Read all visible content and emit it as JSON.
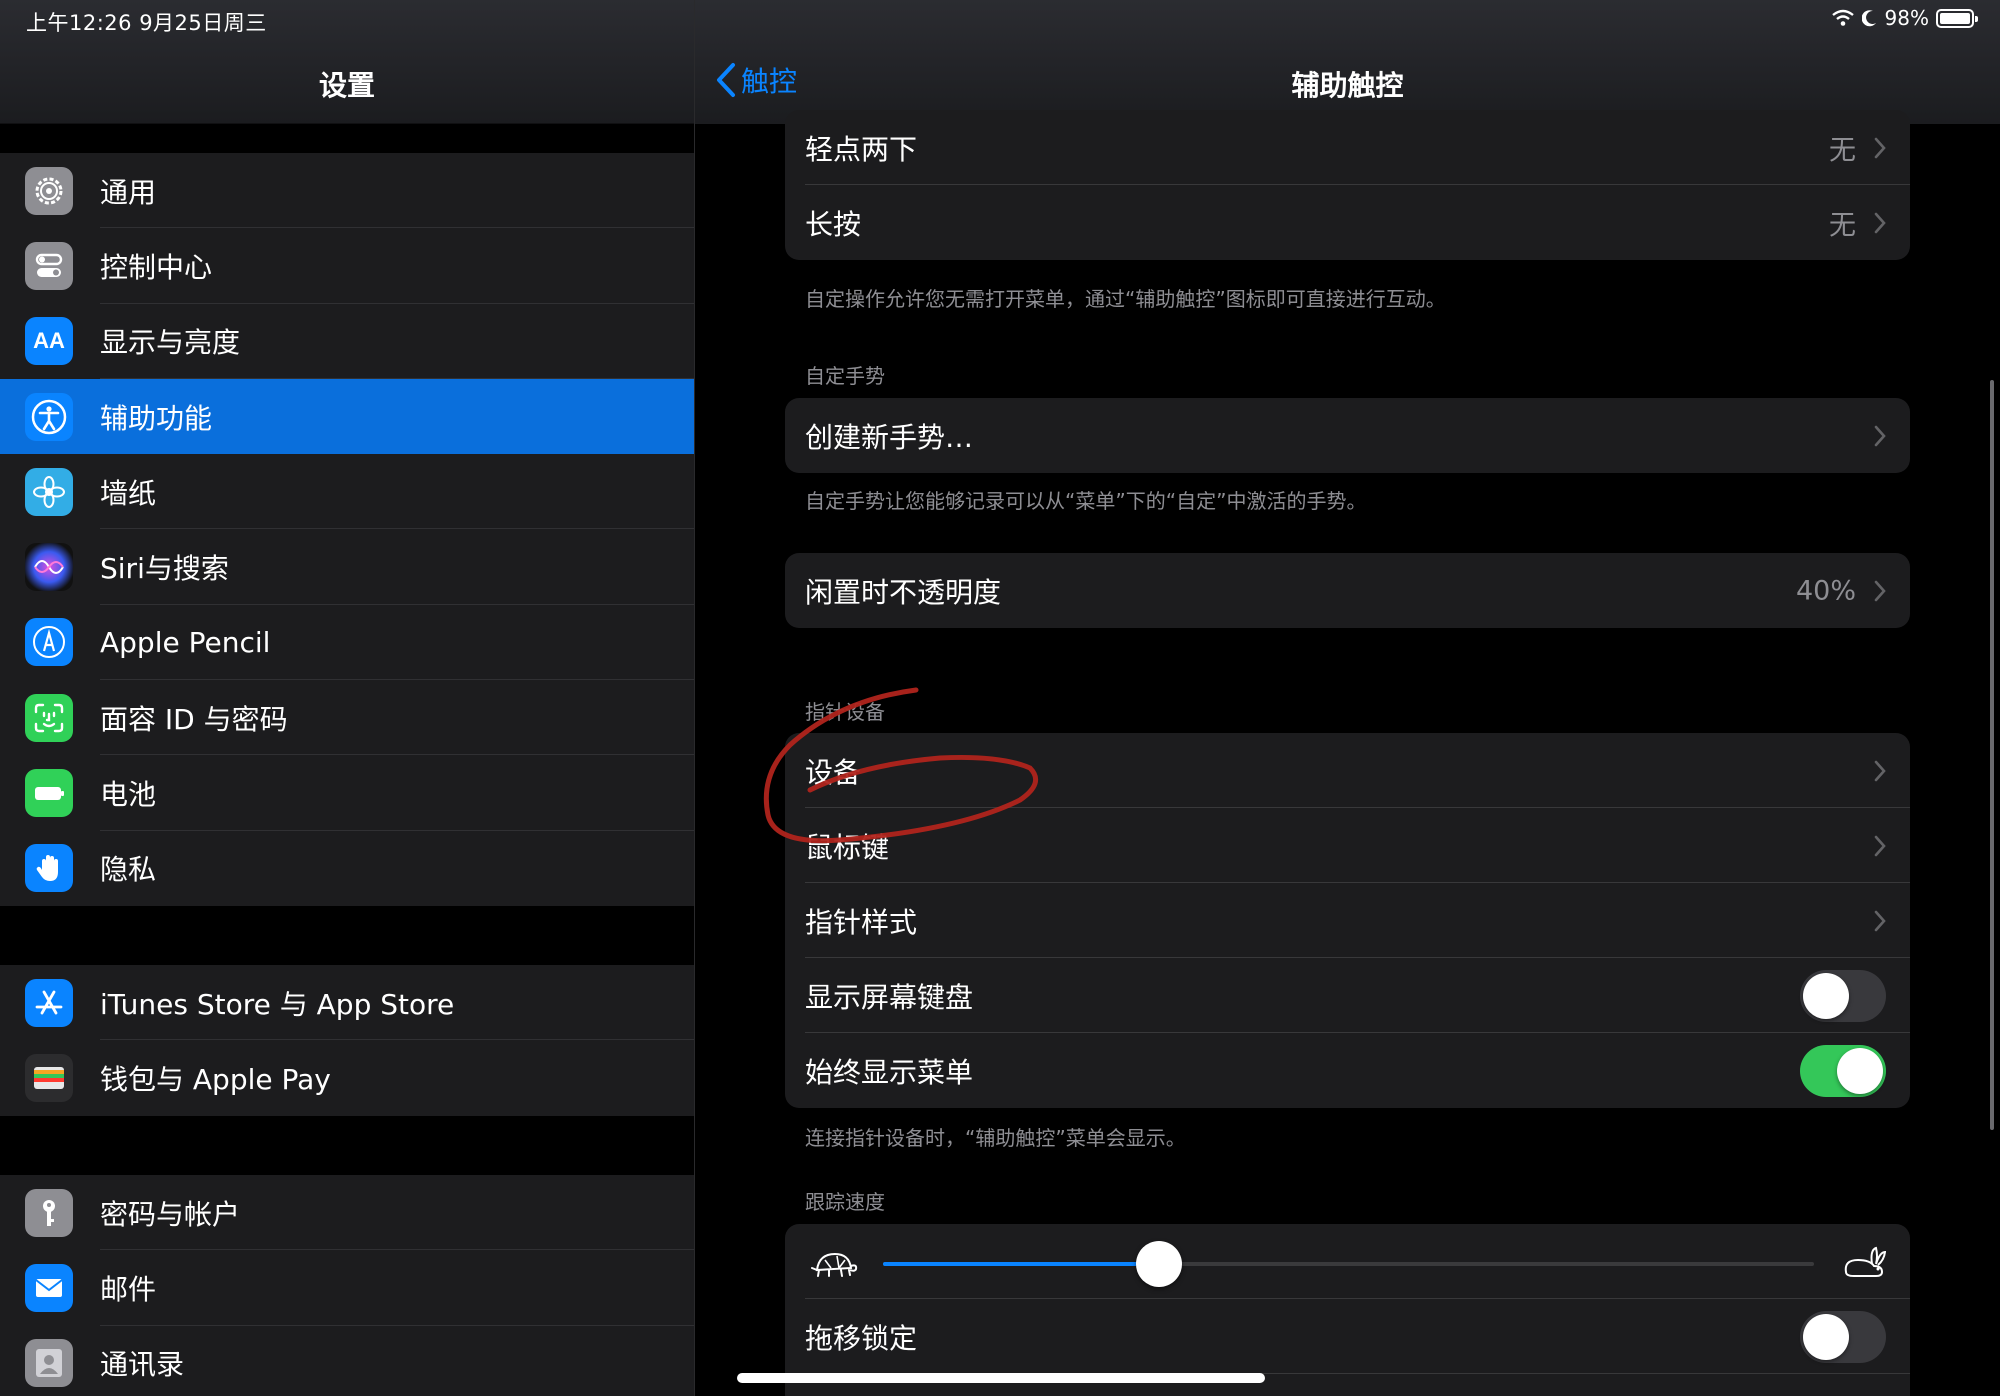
{
  "status_bar": {
    "time": "上午12:26  9月25日周三",
    "battery": "98%"
  },
  "sidebar": {
    "title": "设置",
    "groups": [
      [
        {
          "label": "通用",
          "icon": "gear-icon",
          "color": "#8e8e93"
        },
        {
          "label": "控制中心",
          "icon": "toggles-icon",
          "color": "#8e8e93"
        },
        {
          "label": "显示与亮度",
          "icon": "text-size-icon",
          "color": "#0a84ff"
        },
        {
          "label": "辅助功能",
          "icon": "accessibility-icon",
          "color": "#0a84ff",
          "selected": true
        },
        {
          "label": "墙纸",
          "icon": "flower-icon",
          "color": "#32ade6"
        },
        {
          "label": "Siri与搜索",
          "icon": "siri-icon",
          "color": "#1c1c1e"
        },
        {
          "label": "Apple Pencil",
          "icon": "pencil-icon",
          "color": "#0a84ff"
        },
        {
          "label": "面容 ID 与密码",
          "icon": "face-id-icon",
          "color": "#30d158"
        },
        {
          "label": "电池",
          "icon": "battery-icon",
          "color": "#30d158"
        },
        {
          "label": "隐私",
          "icon": "hand-icon",
          "color": "#0a84ff"
        }
      ],
      [
        {
          "label": "iTunes Store 与 App Store",
          "icon": "app-store-icon",
          "color": "#0a84ff"
        },
        {
          "label": "钱包与 Apple Pay",
          "icon": "wallet-icon",
          "color": "#2c2c2e"
        }
      ],
      [
        {
          "label": "密码与帐户",
          "icon": "key-icon",
          "color": "#8e8e93"
        },
        {
          "label": "邮件",
          "icon": "mail-icon",
          "color": "#0a84ff"
        },
        {
          "label": "通讯录",
          "icon": "contacts-icon",
          "color": "#8e8e93"
        }
      ]
    ]
  },
  "nav": {
    "back_label": "触控",
    "title": "辅助触控"
  },
  "custom_actions": {
    "rows": [
      {
        "label": "轻点两下",
        "value": "无"
      },
      {
        "label": "长按",
        "value": "无"
      }
    ],
    "footnote": "自定操作允许您无需打开菜单，通过“辅助触控”图标即可直接进行互动。"
  },
  "custom_gestures": {
    "header": "自定手势",
    "create_label": "创建新手势…",
    "footnote": "自定手势让您能够记录可以从“菜单”下的“自定”中激活的手势。"
  },
  "idle_opacity": {
    "label": "闲置时不透明度",
    "value": "40%"
  },
  "pointer_devices": {
    "header": "指针设备",
    "devices_label": "设备",
    "mouse_keys_label": "鼠标键",
    "pointer_style_label": "指针样式",
    "show_keyboard_label": "显示屏幕键盘",
    "show_keyboard_on": false,
    "always_show_menu_label": "始终显示菜单",
    "always_show_menu_on": true,
    "footnote": "连接指针设备时，“辅助触控”菜单会显示。"
  },
  "tracking_speed": {
    "header": "跟踪速度",
    "value_fraction": 0.296,
    "slow_icon": "turtle-icon",
    "fast_icon": "rabbit-icon",
    "drag_lock_label": "拖移锁定",
    "drag_lock_on": false
  },
  "colors": {
    "accent": "#0a84ff",
    "toggle_on": "#34c759",
    "annotation": "#b0241c"
  }
}
